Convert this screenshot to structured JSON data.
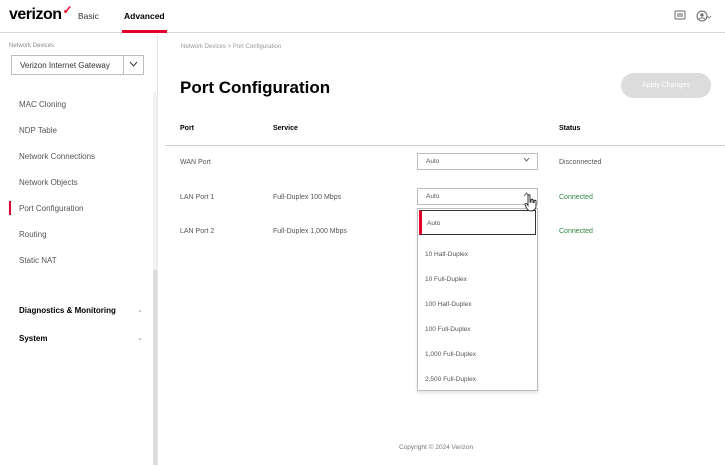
{
  "header": {
    "logo": "verizon",
    "logo_mark": "✓",
    "tabs": [
      {
        "label": "Basic"
      },
      {
        "label": "Advanced"
      }
    ],
    "icons": [
      "messages-icon",
      "user-account-icon"
    ],
    "accent_color": "#e4002b"
  },
  "sidebar": {
    "section_label": "Network Devices",
    "device_select": "Verizon Internet Gateway",
    "items": [
      {
        "label": "MAC Cloning"
      },
      {
        "label": "NDP Table"
      },
      {
        "label": "Network Connections"
      },
      {
        "label": "Network Objects"
      },
      {
        "label": "Port Configuration"
      },
      {
        "label": "Routing"
      },
      {
        "label": "Static NAT"
      }
    ],
    "sections": [
      {
        "label": "Diagnostics & Monitoring"
      },
      {
        "label": "System"
      }
    ]
  },
  "main": {
    "breadcrumb": "Network Devices > Port Configuration",
    "title": "Port Configuration",
    "apply_button": "Apply Changes",
    "columns": [
      "Port",
      "Service",
      "Status"
    ],
    "rows": [
      {
        "port": "WAN Port",
        "service": "",
        "setting": "Auto",
        "status": "Disconnected"
      },
      {
        "port": "LAN Port 1",
        "service": "Full-Duplex 100 Mbps",
        "setting": "Auto",
        "status": "Connected"
      },
      {
        "port": "LAN Port 2",
        "service": "Full-Duplex 1,000 Mbps",
        "setting": "",
        "status": "Connected"
      }
    ],
    "dropdown_options": [
      "Auto",
      "10 Half-Duplex",
      "10 Full-Duplex",
      "100 Half-Duplex",
      "100 Full-Duplex",
      "1,000 Full-Duplex",
      "2,500 Full-Duplex"
    ],
    "status_colors": {
      "connected": "#2e8540",
      "disconnected": "#555555"
    }
  },
  "footer": {
    "copyright": "Copyright © 2024 Verizon"
  }
}
